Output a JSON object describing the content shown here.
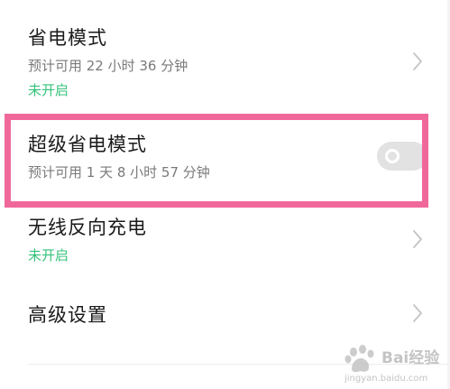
{
  "settings": {
    "items": [
      {
        "title": "省电模式",
        "subtitle": "预计可用 22 小时 36 分钟",
        "status": "未开启"
      },
      {
        "title": "超级省电模式",
        "subtitle": "预计可用 1 天 8 小时 57 分钟",
        "toggle_on": false
      },
      {
        "title": "无线反向充电",
        "status": "未开启"
      },
      {
        "title": "高级设置"
      }
    ]
  },
  "watermark": {
    "brand_text": "Bai经验",
    "url_text": "jingyan.baidu.com"
  },
  "colors": {
    "status_green": "#35c27a",
    "highlight_pink": "#f0689a",
    "toggle_off": "#e2e2e2",
    "title_text": "#1a1a1a",
    "subtitle_text": "#7a7a7a"
  },
  "icons": {
    "row_arrow": "chevron-right-icon",
    "watermark_logo": "paw-icon"
  }
}
